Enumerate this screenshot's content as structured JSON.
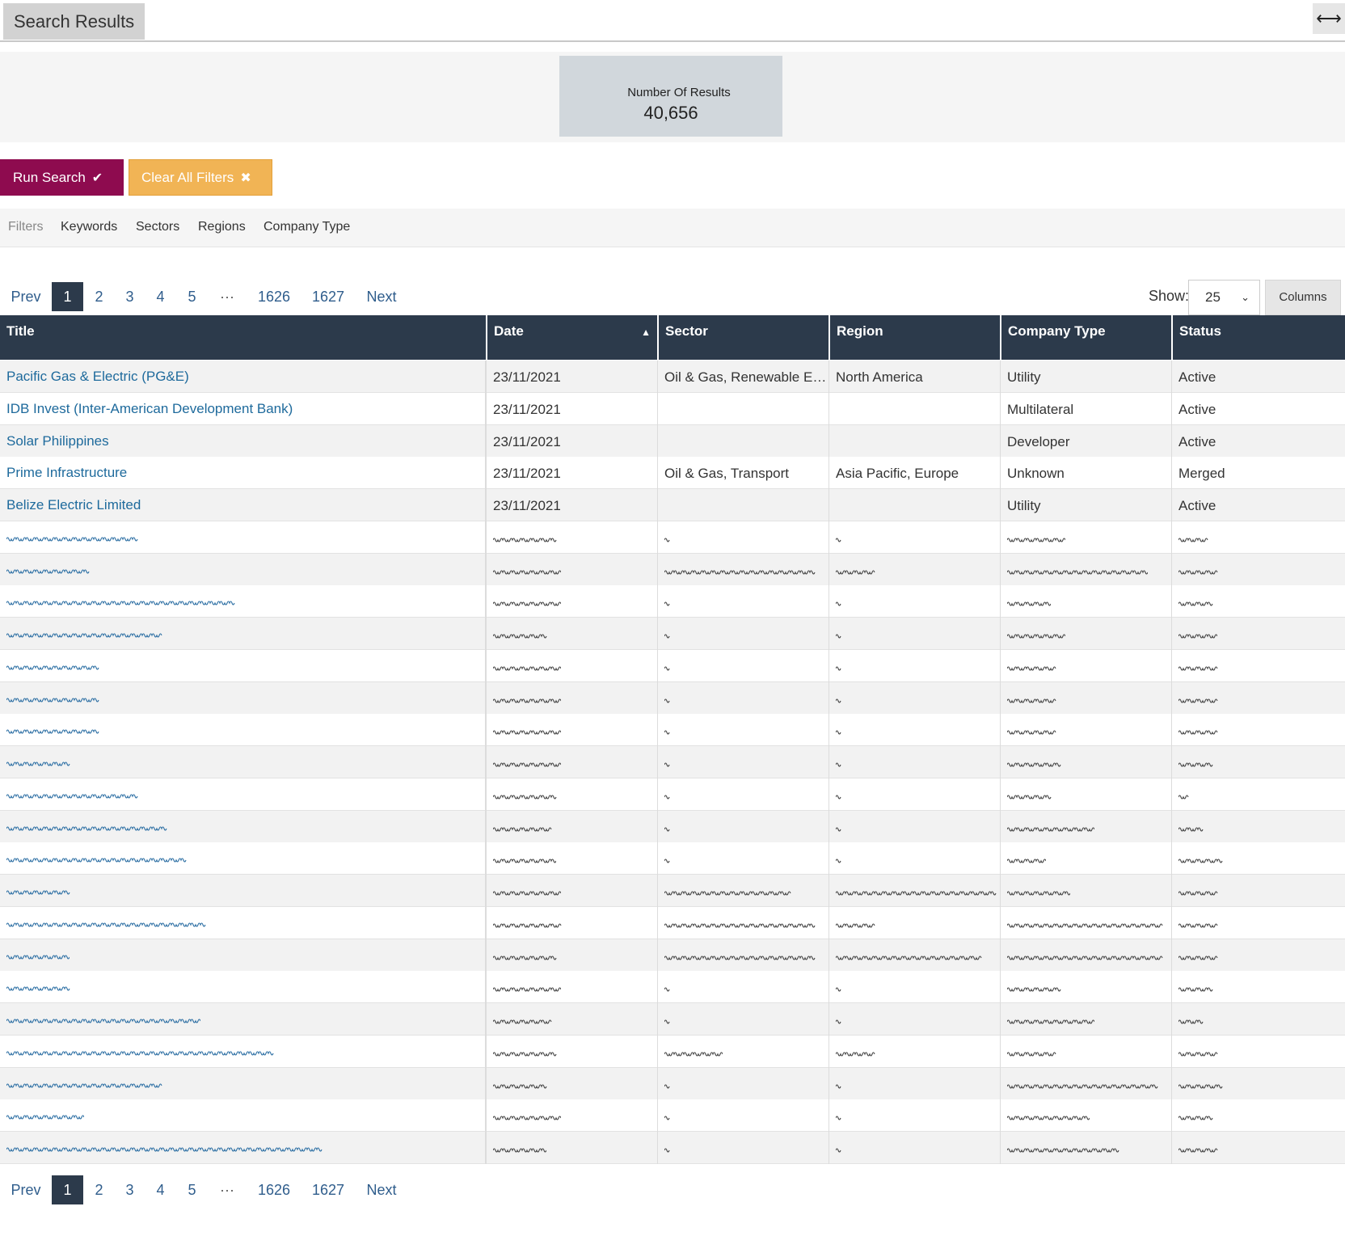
{
  "header": {
    "title": "Search Results",
    "expand_icon": "⟷"
  },
  "stats": {
    "label": "Number Of Results",
    "value": "40,656"
  },
  "actions": {
    "run_label": "Run Search",
    "run_icon": "✔",
    "clear_label": "Clear All Filters",
    "clear_icon": "✖"
  },
  "filters": {
    "label": "Filters",
    "items": [
      "Keywords",
      "Sectors",
      "Regions",
      "Company Type"
    ]
  },
  "pagination": {
    "prev": "Prev",
    "pages": [
      "1",
      "2",
      "3",
      "4",
      "5"
    ],
    "ellipsis": "···",
    "last_pages": [
      "1626",
      "1627"
    ],
    "next": "Next",
    "current": "1"
  },
  "page_size": {
    "label": "Show:",
    "value": "25",
    "columns_label": "Columns"
  },
  "table": {
    "columns": [
      "Title",
      "Date",
      "Sector",
      "Region",
      "Company Type",
      "Status"
    ],
    "sorted_column": "Date",
    "sort_icon": "▲",
    "rows": [
      {
        "title": "Pacific Gas & Electric (PG&E)",
        "date": "23/11/2021",
        "sector": "Oil & Gas, Renewable Energy",
        "region": "North America",
        "company_type": "Utility",
        "status": "Active"
      },
      {
        "title": "IDB Invest (Inter-American Development Bank)",
        "date": "23/11/2021",
        "sector": "",
        "region": "",
        "company_type": "Multilateral",
        "status": "Active"
      },
      {
        "title": "Solar Philippines",
        "date": "23/11/2021",
        "sector": "",
        "region": "",
        "company_type": "Developer",
        "status": "Active"
      },
      {
        "title": "Prime Infrastructure",
        "date": "23/11/2021",
        "sector": "Oil & Gas, Transport",
        "region": "Asia Pacific, Europe",
        "company_type": "Unknown",
        "status": "Merged"
      },
      {
        "title": "Belize Electric Limited",
        "date": "23/11/2021",
        "sector": "",
        "region": "",
        "company_type": "Utility",
        "status": "Active"
      }
    ]
  },
  "colors": {
    "header_bg": "#2c3a4b",
    "run_button": "#8e0b4f",
    "clear_button": "#f1b455",
    "link": "#1e6a9c"
  }
}
